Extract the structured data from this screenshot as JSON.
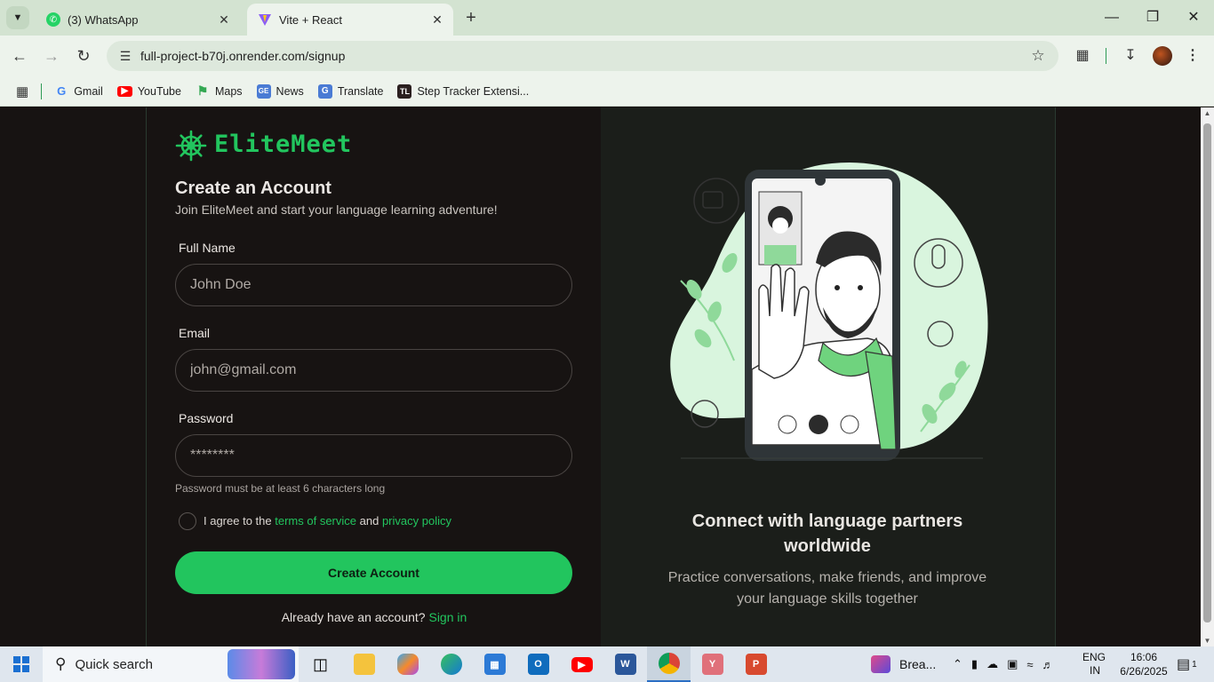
{
  "browser": {
    "tabs": [
      {
        "title": "(3) WhatsApp",
        "active": false
      },
      {
        "title": "Vite + React",
        "active": true
      }
    ],
    "url": "full-project-b70j.onrender.com/signup",
    "bookmarks": [
      "Gmail",
      "YouTube",
      "Maps",
      "News",
      "Translate",
      "Step Tracker Extensi..."
    ]
  },
  "app": {
    "brand": "EliteMeet",
    "title": "Create an Account",
    "subtitle": "Join EliteMeet and start your language learning adventure!",
    "form": {
      "full_name_label": "Full Name",
      "full_name_placeholder": "John Doe",
      "email_label": "Email",
      "email_placeholder": "john@gmail.com",
      "password_label": "Password",
      "password_placeholder": "********",
      "password_hint": "Password must be at least 6 characters long",
      "agree_prefix": "I agree to the",
      "terms_link": "terms of service",
      "agree_and": "and",
      "privacy_link": "privacy policy",
      "submit_label": "Create Account",
      "signin_prompt": "Already have an account?",
      "signin_link": "Sign in"
    },
    "hero": {
      "title": "Connect with language partners worldwide",
      "description": "Practice conversations, make friends, and improve your language skills together"
    },
    "colors": {
      "accent": "#22c55e",
      "background": "#171312",
      "panel": "#1b1e1a"
    }
  },
  "taskbar": {
    "search_label": "Quick search",
    "notification_label": "Brea...",
    "language": "ENG",
    "region": "IN",
    "time": "16:06",
    "date": "6/26/2025",
    "notif_count": "1"
  }
}
